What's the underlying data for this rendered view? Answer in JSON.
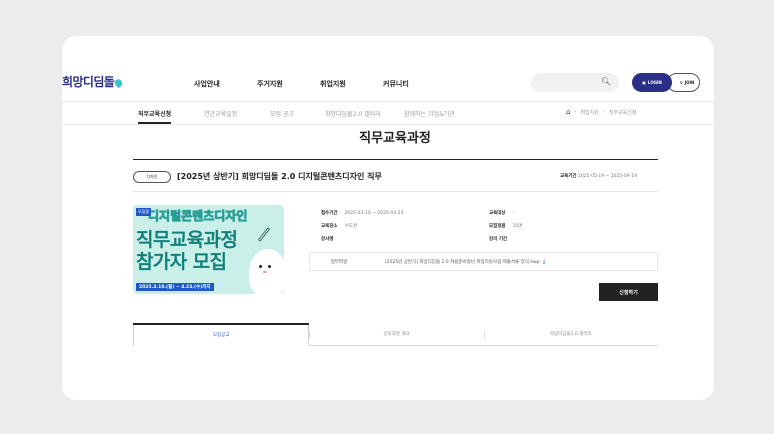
{
  "colors": {
    "brand": "#2b2f86",
    "accent": "#38c7c9",
    "link": "#1e58c9"
  },
  "header": {
    "logo": "희망디딤돌",
    "nav": [
      "사업안내",
      "주거지원",
      "취업지원",
      "커뮤니티"
    ],
    "search_icon": "search-icon",
    "login_label": "LOGIN",
    "join_label": "JOIN"
  },
  "subnav": {
    "items": [
      "직무교육신청",
      "연간교육일정",
      "모집 공고",
      "희망디딤돌2.0 갤러리",
      "함께하는 기업&기관"
    ],
    "active": "직무교육신청",
    "breadcrumb": [
      "취업지원",
      "직무교육신청"
    ]
  },
  "page": {
    "title": "직무교육과정"
  },
  "course": {
    "category_tag": "디자인",
    "title": "[2025년 상반기] 희망디딤돌 2.0 디지털콘텐츠디자인 직무",
    "period_label": "교육기간",
    "period_value": "2025-05-19 ~ 2025-09-19",
    "banner": {
      "badge": "모집중",
      "line1": "디지털콘텐츠디자인",
      "line2": "직무교육과정",
      "line3": "참가자 모집",
      "dates": "2025.3.10.(월) ~ 4.23.(수)까지"
    },
    "info": {
      "apply_period_label": "접수기간",
      "apply_period_value": "2025-03-10 ~ 2025-04-23",
      "target_label": "교육대상",
      "target_value": "-",
      "location_label": "교육장소",
      "location_value": "수도권",
      "capacity_label": "모집정원",
      "capacity_value": "15명",
      "instructor_label": "강사명",
      "instructor_value": "",
      "lecture_period_label": "강의 기간",
      "lecture_period_value": ""
    },
    "attachment_label": "첨부파일",
    "attachment_file": "[2025년 상반기] 희망디딤돌 2.0 자립준비청년 취업지원사업 제출서류 양식.hwp",
    "apply_button": "신청하기"
  },
  "tabs": {
    "items": [
      "모집공고",
      "강의과정 개요",
      "희망디딤돌2.0 갤러리"
    ],
    "active": 0
  }
}
